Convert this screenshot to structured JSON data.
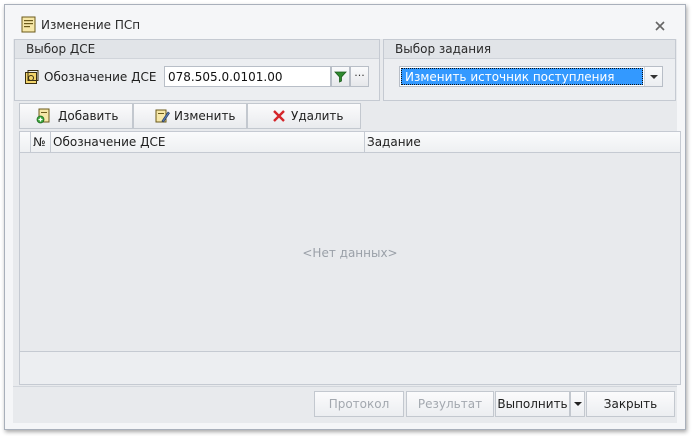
{
  "window": {
    "title": "Изменение ПСп",
    "icons": {
      "app": "document-icon",
      "close": "close-icon"
    }
  },
  "dse_group": {
    "title": "Выбор ДСЕ",
    "label": "Обозначение ДСЕ",
    "value": "078.505.0.0101.00",
    "icons": {
      "label": "part-icon",
      "filter": "filter-icon"
    },
    "browse_label": "···"
  },
  "task_group": {
    "title": "Выбор задания",
    "selected": "Изменить источник поступления"
  },
  "toolbar": {
    "add_label": "Добавить",
    "edit_label": "Изменить",
    "delete_label": "Удалить",
    "icons": {
      "add": "add-document-icon",
      "edit": "edit-icon",
      "delete": "delete-x-icon"
    }
  },
  "grid": {
    "columns": [
      "№",
      "Обозначение ДСЕ",
      "Задание"
    ],
    "empty_text": "<Нет данных>"
  },
  "footer": {
    "protocol_label": "Протокол",
    "result_label": "Результат",
    "execute_label": "Выполнить",
    "close_label": "Закрыть"
  },
  "colors": {
    "selection": "#3399ff",
    "delete_icon": "#d4252a",
    "window_bg": "#f5f6f8"
  }
}
